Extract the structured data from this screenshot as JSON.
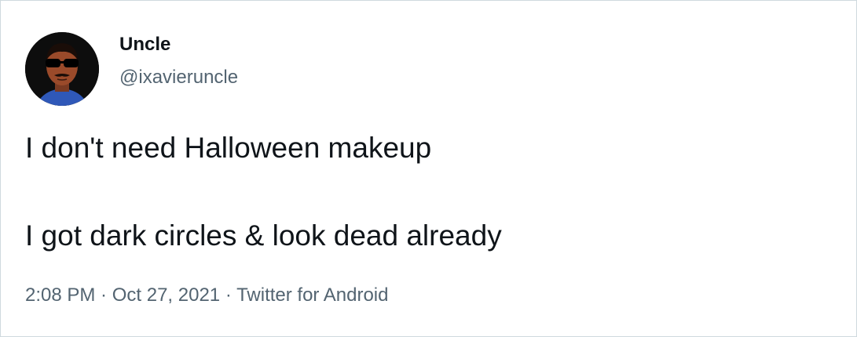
{
  "author": {
    "display_name": "Uncle",
    "handle": "@ixavieruncle"
  },
  "tweet": {
    "line_1": "I don't need Halloween makeup",
    "line_2": "I got dark circles & look dead already"
  },
  "meta": {
    "time": "2:08 PM",
    "separator": " · ",
    "date": "Oct 27, 2021",
    "source": "Twitter for Android"
  },
  "colors": {
    "primary_text": "#0f1419",
    "secondary_text": "#536471",
    "border": "#cfd9de"
  }
}
